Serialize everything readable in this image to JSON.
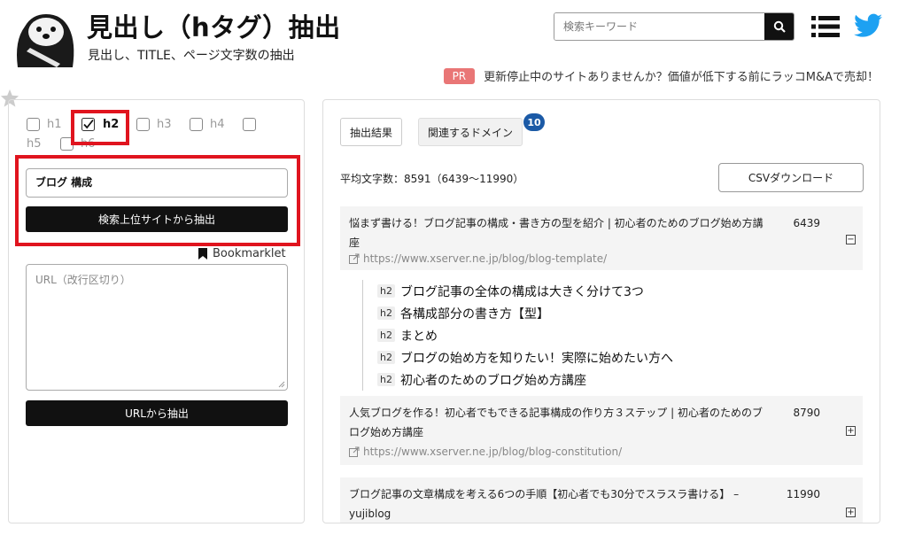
{
  "header": {
    "title": "見出し（hタグ）抽出",
    "subtitle": "見出し、TITLE、ページ文字数の抽出",
    "search_placeholder": "検索キーワード"
  },
  "pr": {
    "badge": "PR",
    "text": "更新停止中のサイトありませんか？価値が低下する前にラッコM&Aで売却！"
  },
  "tags": [
    {
      "label": "h1",
      "checked": false
    },
    {
      "label": "h2",
      "checked": true
    },
    {
      "label": "h3",
      "checked": false
    },
    {
      "label": "h4",
      "checked": false
    },
    {
      "label": "h5",
      "checked": false
    },
    {
      "label": "h6",
      "checked": false
    }
  ],
  "form": {
    "keyword": "ブログ 構成",
    "search_button": "検索上位サイトから抽出",
    "bookmarklet": "Bookmarklet",
    "url_placeholder": "URL（改行区切り）",
    "url_button": "URLから抽出"
  },
  "tabs": {
    "result": "抽出結果",
    "domain": "関連するドメイン",
    "domain_count": "10"
  },
  "summary": {
    "avg": "平均文字数：8591（6439〜11990）",
    "csv_button": "CSVダウンロード"
  },
  "results": [
    {
      "title": "悩まず書ける！ブログ記事の構成・書き方の型を紹介 | 初心者のためのブログ始め方講座",
      "count": "6439",
      "url": "https://www.xserver.ne.jp/blog/blog-template/",
      "toggle": "−",
      "headings": [
        {
          "tag": "h2",
          "text": "ブログ記事の全体の構成は大きく分けて3つ"
        },
        {
          "tag": "h2",
          "text": "各構成部分の書き方【型】"
        },
        {
          "tag": "h2",
          "text": "まとめ"
        },
        {
          "tag": "h2",
          "text": "ブログの始め方を知りたい！実際に始めたい方へ"
        },
        {
          "tag": "h2",
          "text": "初心者のためのブログ始め方講座"
        }
      ]
    },
    {
      "title": "人気ブログを作る！初心者でもできる記事構成の作り方３ステップ | 初心者のためのブログ始め方講座",
      "count": "8790",
      "url": "https://www.xserver.ne.jp/blog/blog-constitution/",
      "toggle": "+"
    },
    {
      "title": "ブログ記事の文章構成を考える6つの手順【初心者でも30分でスラスラ書ける】 – yujiblog",
      "count": "11990",
      "toggle": "+"
    }
  ]
}
